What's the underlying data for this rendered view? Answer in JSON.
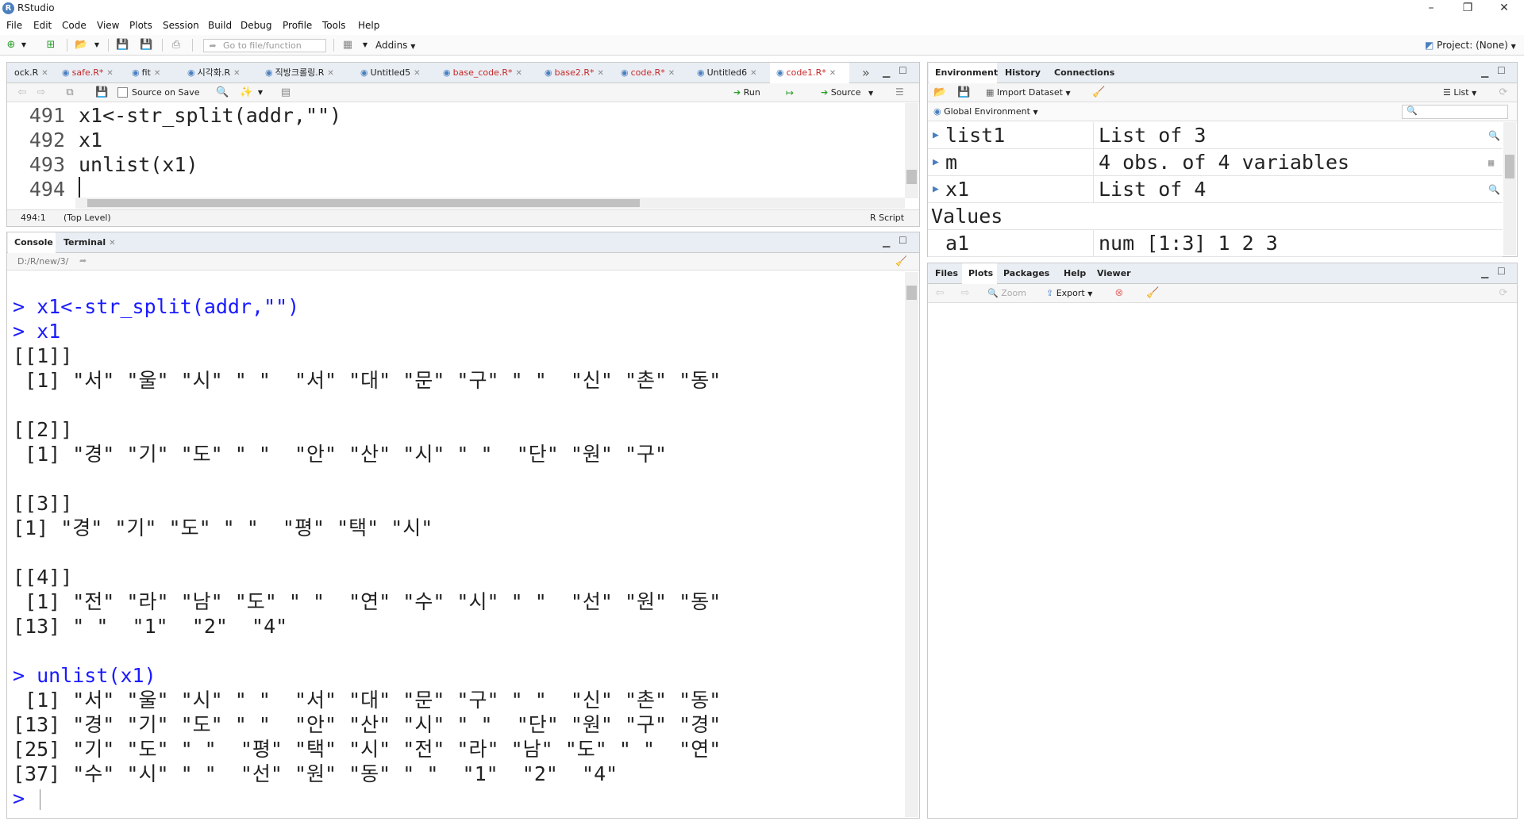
{
  "app": {
    "title": "RStudio",
    "logo": "R"
  },
  "menu": [
    "File",
    "Edit",
    "Code",
    "View",
    "Plots",
    "Session",
    "Build",
    "Debug",
    "Profile",
    "Tools",
    "Help"
  ],
  "toolbar": {
    "goto_placeholder": "Go to file/function",
    "addins": "Addins",
    "project": "Project: (None)"
  },
  "editor": {
    "tabs": [
      {
        "label": "ock.R",
        "mod": false
      },
      {
        "label": "safe.R*",
        "mod": true
      },
      {
        "label": "fit",
        "mod": false
      },
      {
        "label": "시각화.R",
        "mod": false
      },
      {
        "label": "직방크롤링.R",
        "mod": false
      },
      {
        "label": "Untitled5",
        "mod": false
      },
      {
        "label": "base_code.R*",
        "mod": true
      },
      {
        "label": "base2.R*",
        "mod": true
      },
      {
        "label": "code.R*",
        "mod": true
      },
      {
        "label": "Untitled6",
        "mod": false
      },
      {
        "label": "code1.R*",
        "mod": true
      }
    ],
    "source_on_save": "Source on Save",
    "run": "Run",
    "source": "Source",
    "lines": [
      {
        "num": "491",
        "text": "x1<-str_split(addr,\"\")"
      },
      {
        "num": "492",
        "text": "x1"
      },
      {
        "num": "493",
        "text": "unlist(x1)"
      },
      {
        "num": "494",
        "text": ""
      }
    ],
    "status": {
      "pos": "494:1",
      "scope": "(Top Level)",
      "type": "R Script"
    }
  },
  "console": {
    "tabs": [
      "Console",
      "Terminal"
    ],
    "path": "D:/R/new/3/",
    "lines": [
      {
        "t": "",
        "c": false
      },
      {
        "t": "> x1<-str_split(addr,\"\")",
        "c": true
      },
      {
        "t": "> x1",
        "c": true
      },
      {
        "t": "[[1]]",
        "c": false
      },
      {
        "t": " [1] \"서\" \"울\" \"시\" \" \"  \"서\" \"대\" \"문\" \"구\" \" \"  \"신\" \"촌\" \"동\"",
        "c": false
      },
      {
        "t": "",
        "c": false
      },
      {
        "t": "[[2]]",
        "c": false
      },
      {
        "t": " [1] \"경\" \"기\" \"도\" \" \"  \"안\" \"산\" \"시\" \" \"  \"단\" \"원\" \"구\"",
        "c": false
      },
      {
        "t": "",
        "c": false
      },
      {
        "t": "[[3]]",
        "c": false
      },
      {
        "t": "[1] \"경\" \"기\" \"도\" \" \"  \"평\" \"택\" \"시\"",
        "c": false
      },
      {
        "t": "",
        "c": false
      },
      {
        "t": "[[4]]",
        "c": false
      },
      {
        "t": " [1] \"전\" \"라\" \"남\" \"도\" \" \"  \"연\" \"수\" \"시\" \" \"  \"선\" \"원\" \"동\"",
        "c": false
      },
      {
        "t": "[13] \" \"  \"1\"  \"2\"  \"4\"",
        "c": false
      },
      {
        "t": "",
        "c": false
      },
      {
        "t": "> unlist(x1)",
        "c": true
      },
      {
        "t": " [1] \"서\" \"울\" \"시\" \" \"  \"서\" \"대\" \"문\" \"구\" \" \"  \"신\" \"촌\" \"동\"",
        "c": false
      },
      {
        "t": "[13] \"경\" \"기\" \"도\" \" \"  \"안\" \"산\" \"시\" \" \"  \"단\" \"원\" \"구\" \"경\"",
        "c": false
      },
      {
        "t": "[25] \"기\" \"도\" \" \"  \"평\" \"택\" \"시\" \"전\" \"라\" \"남\" \"도\" \" \"  \"연\"",
        "c": false
      },
      {
        "t": "[37] \"수\" \"시\" \" \"  \"선\" \"원\" \"동\" \" \"  \"1\"  \"2\"  \"4\"",
        "c": false
      },
      {
        "t": ">",
        "c": true
      }
    ]
  },
  "env": {
    "tabs": [
      "Environment",
      "History",
      "Connections"
    ],
    "import": "Import Dataset",
    "list": "List",
    "scope": "Global Environment",
    "rows": [
      {
        "name": "list1",
        "value": "List of 3"
      },
      {
        "name": "m",
        "value": "4 obs. of 4 variables"
      },
      {
        "name": "x1",
        "value": "List of 4"
      }
    ],
    "values_header": "Values",
    "values": [
      {
        "name": "a1",
        "value": "num [1:3] 1 2 3"
      }
    ]
  },
  "files": {
    "tabs": [
      "Files",
      "Plots",
      "Packages",
      "Help",
      "Viewer"
    ],
    "zoom": "Zoom",
    "export": "Export"
  }
}
